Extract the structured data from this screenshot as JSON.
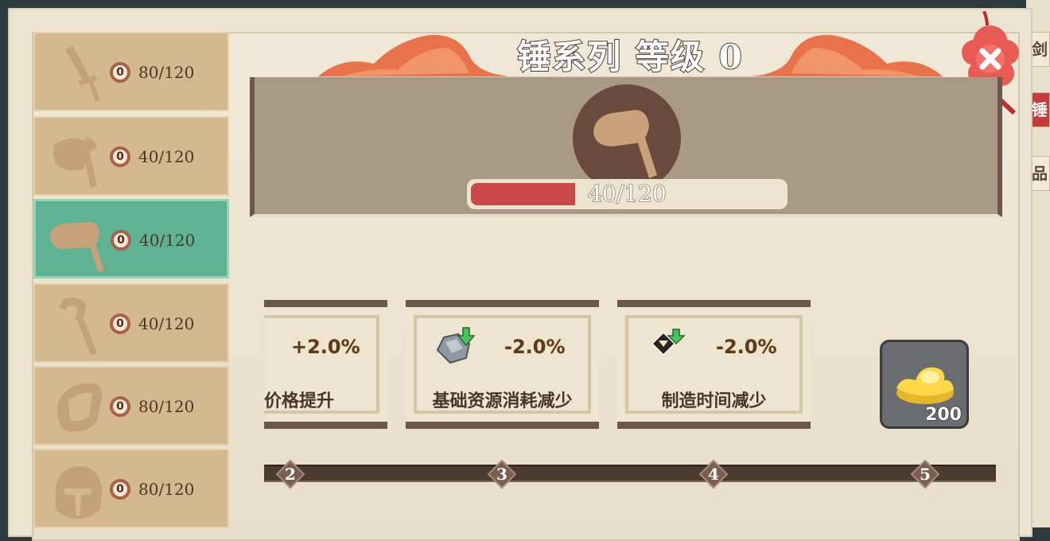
{
  "right_tabs": [
    "剑",
    "锤",
    "品"
  ],
  "sidebar": {
    "items": [
      {
        "weapon_icon": "sword-icon",
        "level": "0",
        "count": "80/120",
        "active": false
      },
      {
        "weapon_icon": "axe-icon",
        "level": "0",
        "count": "40/120",
        "active": false
      },
      {
        "weapon_icon": "hammer-icon",
        "level": "0",
        "count": "40/120",
        "active": true
      },
      {
        "weapon_icon": "staff-icon",
        "level": "0",
        "count": "40/120",
        "active": false
      },
      {
        "weapon_icon": "bracer-icon",
        "level": "0",
        "count": "80/120",
        "active": false
      },
      {
        "weapon_icon": "helmet-icon",
        "level": "0",
        "count": "80/120",
        "active": false
      }
    ]
  },
  "header": {
    "title": "锤系列 等级 0",
    "icon": "hammer-icon",
    "progress_text": "40/120",
    "progress_fraction": 0.333
  },
  "cards": [
    {
      "icon": "",
      "value": "+2.0%",
      "label": "卖价格提升"
    },
    {
      "icon": "ore-down-icon",
      "value": "-2.0%",
      "label": "基础资源消耗减少"
    },
    {
      "icon": "time-down-icon",
      "value": "-2.0%",
      "label": "制造时间减少"
    }
  ],
  "reward": {
    "icon": "gold-ingot-icon",
    "count": "200"
  },
  "track": {
    "nodes": [
      "2",
      "3",
      "4",
      "5"
    ]
  },
  "colors": {
    "accent_green": "#5fb393",
    "progress_red": "#c94848",
    "panel_brown": "#6b5848"
  }
}
